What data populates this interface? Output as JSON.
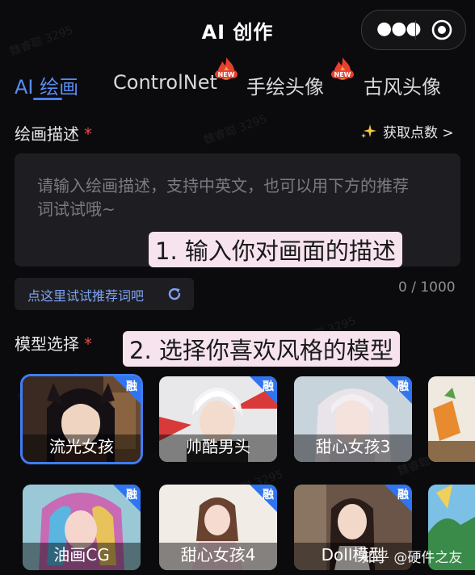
{
  "header": {
    "title": "AI 创作"
  },
  "tabs": [
    {
      "label": "AI 绘画",
      "active": true
    },
    {
      "label": "ControlNet",
      "badge": "NEW"
    },
    {
      "label": "手绘头像",
      "badge": "NEW"
    },
    {
      "label": "古风头像"
    }
  ],
  "prompt": {
    "label": "绘画描述",
    "required_mark": "*",
    "points_link": "获取点数 >",
    "placeholder": "请输入绘画描述，支持中英文，也可以用下方的推荐词试试哦~",
    "callout": "1. 输入你对画面的描述",
    "try_button": "点这里试试推荐词吧",
    "counter": "0 / 1000"
  },
  "model": {
    "label": "模型选择",
    "required_mark": "*",
    "callout": "2. 选择你喜欢风格的模型",
    "badge": "融",
    "cards": [
      {
        "name": "流光女孩",
        "selected": true
      },
      {
        "name": "帅酷男头"
      },
      {
        "name": "甜心女孩3"
      },
      {
        "name": ""
      },
      {
        "name": "油画CG"
      },
      {
        "name": "甜心女孩4"
      },
      {
        "name": "Doll模型"
      },
      {
        "name": ""
      }
    ]
  },
  "watermark": "魏睿聪 3295",
  "source_watermark": "知乎 @硬件之友",
  "colors": {
    "accent": "#4f7df0",
    "required": "#e24b4b",
    "callout_bg": "#f6e3ee",
    "badge_bg": "#2f74f1"
  }
}
